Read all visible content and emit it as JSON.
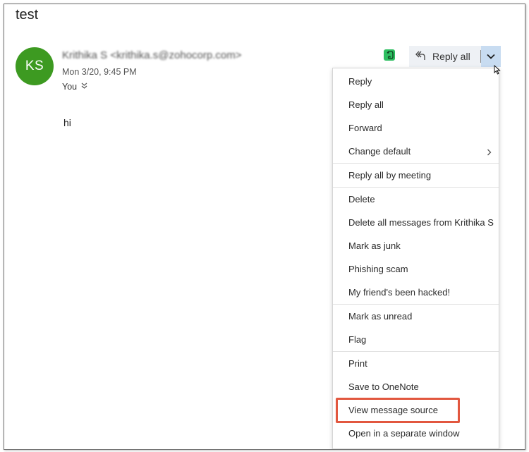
{
  "message": {
    "subject": "test",
    "avatar_initials": "KS",
    "sender": "Krithika S <krithika.s@zohocorp.com>",
    "date": "Mon 3/20, 9:45 PM",
    "to": "You",
    "body": "hi"
  },
  "toolbar": {
    "reply_all_label": "Reply all"
  },
  "menu": {
    "reply": "Reply",
    "reply_all": "Reply all",
    "forward": "Forward",
    "change_default": "Change default",
    "reply_all_by_meeting": "Reply all by meeting",
    "delete": "Delete",
    "delete_all_from": "Delete all messages from Krithika S",
    "mark_as_junk": "Mark as junk",
    "phishing_scam": "Phishing scam",
    "friend_hacked": "My friend's been hacked!",
    "mark_as_unread": "Mark as unread",
    "flag": "Flag",
    "print": "Print",
    "save_to_onenote": "Save to OneNote",
    "view_message_source": "View message source",
    "open_separate_window": "Open in a separate window"
  },
  "colors": {
    "avatar_bg": "#3d9a21",
    "evernote_green": "#2dbe60",
    "split_button_bg": "#eef1f5",
    "caret_active_bg": "#c8dcf1",
    "highlight_red": "#e2573f"
  },
  "icons": {
    "evernote": "evernote-icon",
    "reply_all": "reply-all-icon",
    "caret": "chevron-down-icon",
    "submenu": "chevron-right-icon",
    "expand_recipients": "double-chevron-down-icon"
  }
}
